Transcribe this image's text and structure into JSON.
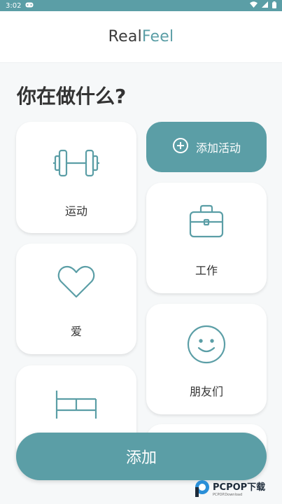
{
  "status_bar": {
    "time": "3:02"
  },
  "header": {
    "logo_part1": "Real",
    "logo_part2": "Feel"
  },
  "main": {
    "title": "你在做什么?",
    "add_activity_label": "添加活动",
    "activities": [
      {
        "label": "运动",
        "icon": "dumbbell-icon"
      },
      {
        "label": "爱",
        "icon": "heart-icon"
      },
      {
        "label": "",
        "icon": "bed-icon"
      },
      {
        "label": "工作",
        "icon": "briefcase-icon"
      },
      {
        "label": "朋友们",
        "icon": "smiley-icon"
      }
    ]
  },
  "footer": {
    "add_label": "添加"
  },
  "watermark": {
    "text": "PCPOP下载",
    "sub": "PCPOP.Download"
  },
  "colors": {
    "accent": "#5b9ea6",
    "background": "#f6f8f9",
    "card": "#ffffff",
    "text": "#333333"
  }
}
